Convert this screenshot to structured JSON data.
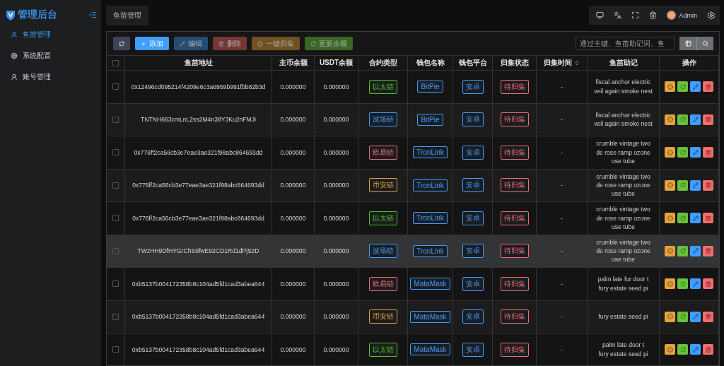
{
  "sidebar": {
    "brand": "管理后台",
    "items": [
      {
        "label": "鱼苗管理",
        "selected": true
      },
      {
        "label": "系统配置",
        "selected": false
      },
      {
        "label": "账号管理",
        "selected": false
      }
    ]
  },
  "tabs": [
    {
      "label": "鱼苗管理",
      "selected": true
    }
  ],
  "user": {
    "name": "Admin"
  },
  "toolbar": {
    "buttons": [
      {
        "kind": "refresh",
        "disabled": false
      },
      {
        "kind": "add",
        "label": "添加",
        "disabled": false
      },
      {
        "kind": "edit",
        "label": "编辑",
        "disabled": true
      },
      {
        "kind": "delete",
        "label": "删除",
        "disabled": true
      },
      {
        "kind": "collect",
        "label": "一键归集",
        "disabled": true
      },
      {
        "kind": "update",
        "label": "更新余额",
        "disabled": true
      }
    ]
  },
  "search": {
    "placeholder": "通过主键、鱼苗助记词、鱼"
  },
  "table": {
    "header_checked": false,
    "columns": [
      {
        "label": "鱼苗地址"
      },
      {
        "label": "主币余额"
      },
      {
        "label": "USDT余额"
      },
      {
        "label": "合约类型"
      },
      {
        "label": "钱包名称"
      },
      {
        "label": "钱包平台"
      },
      {
        "label": "归集状态"
      },
      {
        "label": "归集时间",
        "sortable": true
      },
      {
        "label": "鱼苗助记"
      },
      {
        "label": "操作"
      }
    ],
    "rows": [
      {
        "checked": false,
        "hover": false,
        "address": "0x12496cd095214f4209e6c3a6959b991fbb82b3d",
        "main": "0.000000",
        "usdt": "0.000000",
        "chain": {
          "label": "以太链",
          "color": "#52c41a"
        },
        "wallet": "BitPie",
        "platform": "安卓",
        "status": "待归集",
        "time": "-",
        "mnemonic": [
          "fiscal anchor electric",
          "veil again smoke nest"
        ]
      },
      {
        "checked": false,
        "hover": false,
        "address": "TNTNH663cmLnL2ss2M4n38Y3Ku2nFMJi",
        "main": "0.000000",
        "usdt": "0.000000",
        "chain": {
          "label": "波场链",
          "color": "#409eff"
        },
        "wallet": "BitPie",
        "platform": "安卓",
        "status": "待归集",
        "time": "-",
        "mnemonic": [
          "fiscal anchor electric",
          "veil again smoke nest"
        ]
      },
      {
        "checked": false,
        "hover": false,
        "address": "0x776ff2ca56cb3e7eae3ae321f98abc864693dd",
        "main": "0.000000",
        "usdt": "0.000000",
        "chain": {
          "label": "欧易链",
          "color": "#f56c6c"
        },
        "wallet": "TronLink",
        "platform": "安卓",
        "status": "待归集",
        "time": "-",
        "mnemonic": [
          "crumble vintage two",
          "de rose ramp ozone",
          "use tube"
        ]
      },
      {
        "checked": false,
        "hover": false,
        "address": "0x776ff2ca56cb3e77eae3ae321f98abc864693dd",
        "main": "0.000000",
        "usdt": "0.000000",
        "chain": {
          "label": "币安链",
          "color": "#e6a23c"
        },
        "wallet": "TronLink",
        "platform": "安卓",
        "status": "待归集",
        "time": "-",
        "mnemonic": [
          "crumble vintage two",
          "de rose ramp ozone",
          "use tube"
        ]
      },
      {
        "checked": false,
        "hover": false,
        "address": "0x776ff2ca56cb3e77eae3ae321f98abc864693dd",
        "main": "0.000000",
        "usdt": "0.000000",
        "chain": {
          "label": "以太链",
          "color": "#52c41a"
        },
        "wallet": "TronLink",
        "platform": "安卓",
        "status": "待归集",
        "time": "-",
        "mnemonic": [
          "crumble vintage two",
          "de rose ramp ozone",
          "use tube"
        ]
      },
      {
        "checked": false,
        "hover": true,
        "address": "TWzHH9DfHYGrChS9fwE92CD1Rd1dPjSzD",
        "main": "0.000000",
        "usdt": "0.000000",
        "chain": {
          "label": "波场链",
          "color": "#409eff"
        },
        "wallet": "TronLink",
        "platform": "安卓",
        "status": "待归集",
        "time": "-",
        "mnemonic": [
          "crumble vintage two",
          "de rose ramp ozone",
          "use tube"
        ]
      },
      {
        "checked": false,
        "hover": false,
        "address": "0xb5137b004172358b8c104ad5fd1cad3abea644",
        "main": "0.000000",
        "usdt": "0.000000",
        "chain": {
          "label": "欧易链",
          "color": "#f56c6c"
        },
        "wallet": "MataMask",
        "platform": "安卓",
        "status": "待归集",
        "time": "-",
        "mnemonic": [
          "palm late fur door t",
          "fury estate seed pi"
        ]
      },
      {
        "checked": false,
        "hover": false,
        "address": "0xb5137b004172358b8c104ad5fd1cad3abea644",
        "main": "0.000000",
        "usdt": "0.000000",
        "chain": {
          "label": "币安链",
          "color": "#e6a23c"
        },
        "wallet": "MataMask",
        "platform": "安卓",
        "status": "待归集",
        "time": "-",
        "mnemonic": [
          "fury estate seed pi"
        ]
      },
      {
        "checked": false,
        "hover": false,
        "address": "0xb5137b004172358b8c104ad5fd1cad3abea644",
        "main": "0.000000",
        "usdt": "0.000000",
        "chain": {
          "label": "以太链",
          "color": "#52c41a"
        },
        "wallet": "MataMask",
        "platform": "安卓",
        "status": "待归集",
        "time": "-",
        "mnemonic": [
          "palm late door t",
          "fury estate seed pi"
        ]
      }
    ]
  }
}
